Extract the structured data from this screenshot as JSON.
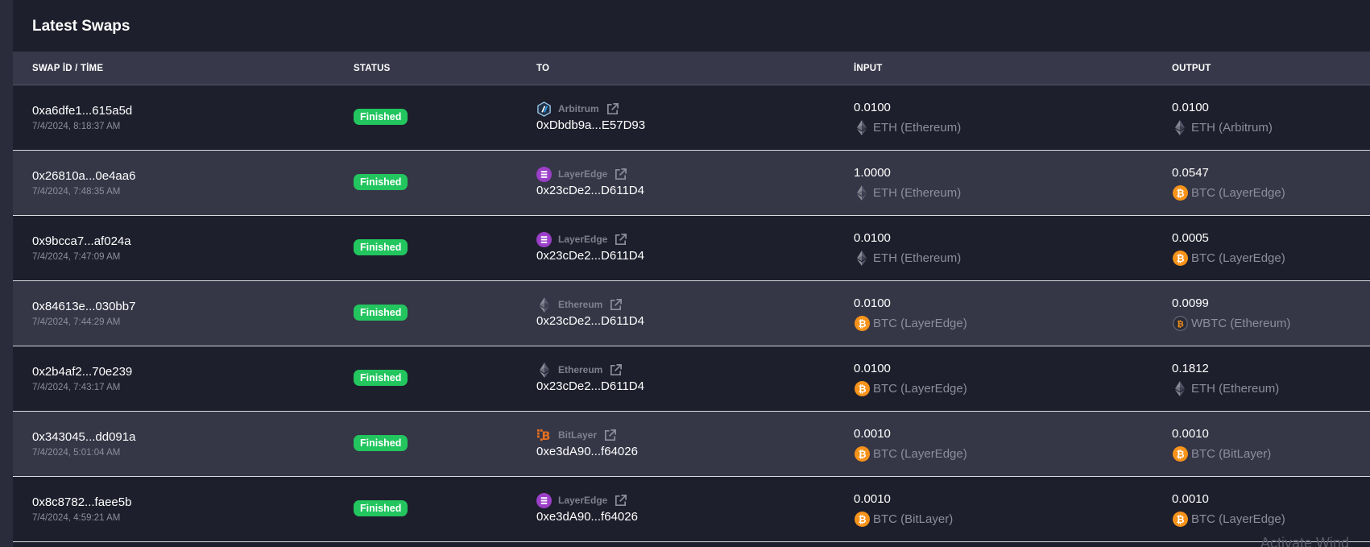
{
  "title": "Latest Swaps",
  "columns": {
    "swap": "SWAP İD / TİME",
    "status": "STATUS",
    "to": "TO",
    "input": "İNPUT",
    "output": "OUTPUT"
  },
  "rows": [
    {
      "id": "0xa6dfe1...615a5d",
      "time": "7/4/2024, 8:18:37 AM",
      "status": "Finished",
      "to_chain": "Arbitrum",
      "to_chain_icon": "arbitrum-icon",
      "to_address": "0xDbdb9a...E57D93",
      "input_amount": "0.0100",
      "input_asset": "ETH (Ethereum)",
      "input_icon": "eth-icon",
      "output_amount": "0.0100",
      "output_asset": "ETH (Arbitrum)",
      "output_icon": "eth-icon"
    },
    {
      "id": "0x26810a...0e4aa6",
      "time": "7/4/2024, 7:48:35 AM",
      "status": "Finished",
      "to_chain": "LayerEdge",
      "to_chain_icon": "layeredge-icon",
      "to_address": "0x23cDe2...D611D4",
      "input_amount": "1.0000",
      "input_asset": "ETH (Ethereum)",
      "input_icon": "eth-icon",
      "output_amount": "0.0547",
      "output_asset": "BTC (LayerEdge)",
      "output_icon": "btc-icon"
    },
    {
      "id": "0x9bcca7...af024a",
      "time": "7/4/2024, 7:47:09 AM",
      "status": "Finished",
      "to_chain": "LayerEdge",
      "to_chain_icon": "layeredge-icon",
      "to_address": "0x23cDe2...D611D4",
      "input_amount": "0.0100",
      "input_asset": "ETH (Ethereum)",
      "input_icon": "eth-icon",
      "output_amount": "0.0005",
      "output_asset": "BTC (LayerEdge)",
      "output_icon": "btc-icon"
    },
    {
      "id": "0x84613e...030bb7",
      "time": "7/4/2024, 7:44:29 AM",
      "status": "Finished",
      "to_chain": "Ethereum",
      "to_chain_icon": "eth-icon",
      "to_address": "0x23cDe2...D611D4",
      "input_amount": "0.0100",
      "input_asset": "BTC (LayerEdge)",
      "input_icon": "btc-icon",
      "output_amount": "0.0099",
      "output_asset": "WBTC (Ethereum)",
      "output_icon": "wbtc-icon"
    },
    {
      "id": "0x2b4af2...70e239",
      "time": "7/4/2024, 7:43:17 AM",
      "status": "Finished",
      "to_chain": "Ethereum",
      "to_chain_icon": "eth-icon",
      "to_address": "0x23cDe2...D611D4",
      "input_amount": "0.0100",
      "input_asset": "BTC (LayerEdge)",
      "input_icon": "btc-icon",
      "output_amount": "0.1812",
      "output_asset": "ETH (Ethereum)",
      "output_icon": "eth-icon"
    },
    {
      "id": "0x343045...dd091a",
      "time": "7/4/2024, 5:01:04 AM",
      "status": "Finished",
      "to_chain": "BitLayer",
      "to_chain_icon": "bitlayer-icon",
      "to_address": "0xe3dA90...f64026",
      "input_amount": "0.0010",
      "input_asset": "BTC (LayerEdge)",
      "input_icon": "btc-icon",
      "output_amount": "0.0010",
      "output_asset": "BTC (BitLayer)",
      "output_icon": "btc-icon"
    },
    {
      "id": "0x8c8782...faee5b",
      "time": "7/4/2024, 4:59:21 AM",
      "status": "Finished",
      "to_chain": "LayerEdge",
      "to_chain_icon": "layeredge-icon",
      "to_address": "0xe3dA90...f64026",
      "input_amount": "0.0010",
      "input_asset": "BTC (BitLayer)",
      "input_icon": "btc-icon",
      "output_amount": "0.0010",
      "output_asset": "BTC (LayerEdge)",
      "output_icon": "btc-icon"
    }
  ],
  "watermark": "Activate Wind",
  "colors": {
    "background": "#1e1f2c",
    "row_alt": "#353646",
    "header": "#373849",
    "status_finished": "#22c55e",
    "btc": "#f7931a",
    "layeredge": "#9b3fc8"
  }
}
